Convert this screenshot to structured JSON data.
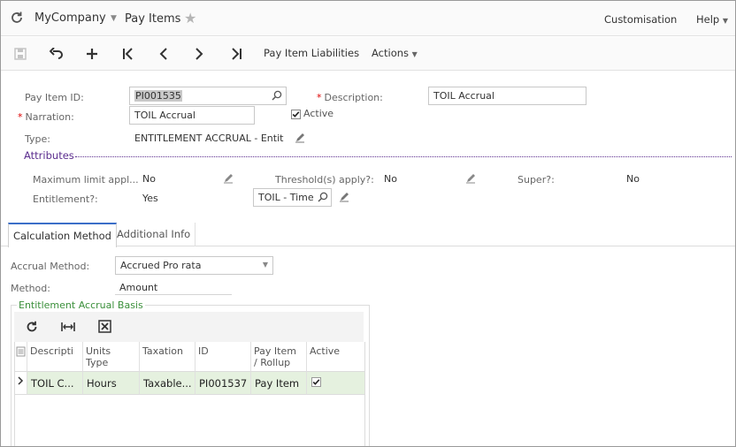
{
  "header": {
    "company": "MyCompany",
    "screen_title": "Pay Items",
    "customisation": "Customisation",
    "help": "Help"
  },
  "toolbar": {
    "liabilities_label": "Pay Item Liabilities",
    "actions_label": "Actions"
  },
  "form": {
    "pay_item_id": {
      "label": "Pay Item ID:",
      "value": "PI001535"
    },
    "description": {
      "label": "Description:",
      "value": "TOIL Accrual"
    },
    "narration": {
      "label": "Narration:",
      "value": "TOIL Accrual"
    },
    "active": {
      "label": "Active",
      "checked": true
    },
    "type": {
      "label": "Type:",
      "value": "ENTITLEMENT ACCRUAL - Entit"
    }
  },
  "attributes": {
    "title": "Attributes",
    "max_limit": {
      "label": "Maximum limit appl...",
      "value": "No"
    },
    "thresholds": {
      "label": "Threshold(s) apply?:",
      "value": "No"
    },
    "super": {
      "label": "Super?:",
      "value": "No"
    },
    "entitlement": {
      "label": "Entitlement?:",
      "value": "Yes"
    },
    "entitlement_item": "TOIL - Time"
  },
  "tabs": [
    {
      "label": "Calculation Method",
      "active": true
    },
    {
      "label": "Additional Info",
      "active": false
    }
  ],
  "calc": {
    "accrual_method": {
      "label": "Accrual Method:",
      "value": "Accrued Pro rata"
    },
    "method": {
      "label": "Method:",
      "value": "Amount"
    }
  },
  "grid": {
    "title": "Entitlement Accrual Basis",
    "columns": [
      "Descripti",
      "Units Type",
      "Taxation",
      "ID",
      "Pay Item / Rollup",
      "Active"
    ],
    "columns_split": [
      [
        "Descripti",
        ""
      ],
      [
        "Units",
        "Type"
      ],
      [
        "Taxation",
        ""
      ],
      [
        "ID",
        ""
      ],
      [
        "Pay Item",
        "/ Rollup"
      ],
      [
        "Active",
        ""
      ]
    ],
    "rows": [
      {
        "description": "TOIL C...",
        "units_type": "Hours",
        "taxation": "Taxable...",
        "id": "PI001537",
        "pay_item": "Pay Item",
        "active": true
      }
    ]
  },
  "colors": {
    "accent": "#5b2d8e",
    "tab_active": "#3b6ec8",
    "group_title": "#3a8f3a",
    "row_selected": "#e5f1df"
  }
}
